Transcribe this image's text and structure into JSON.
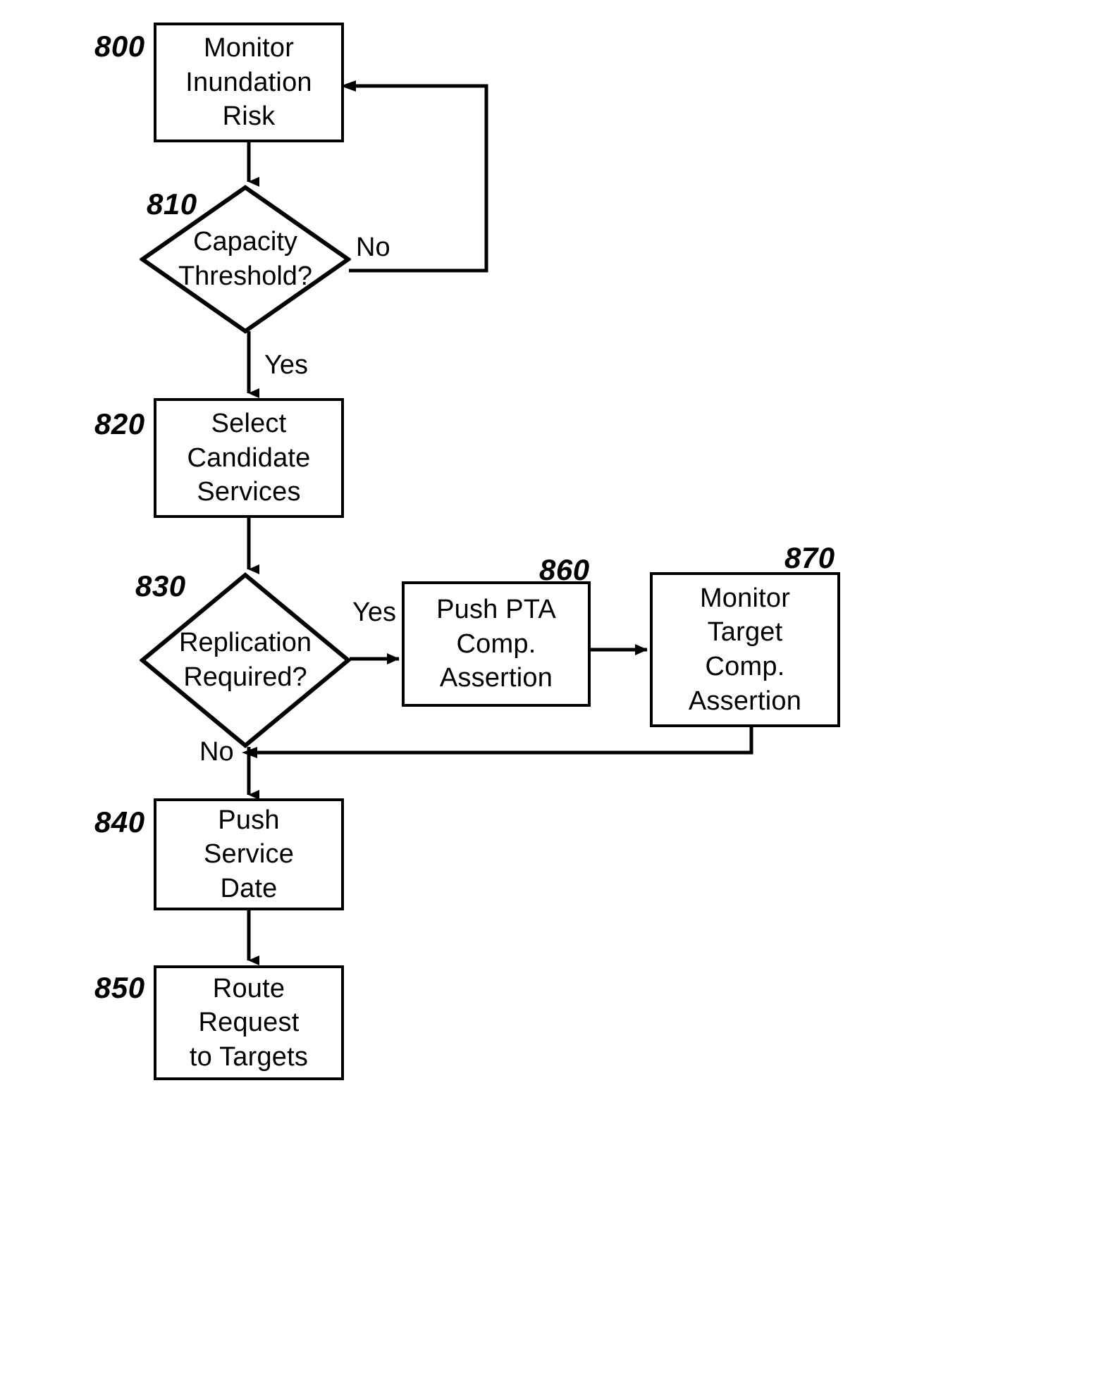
{
  "figure": {
    "kind": "patent-flowchart",
    "background_color": "#ffffff",
    "line_color": "#000000"
  },
  "nodes": {
    "n800": {
      "ref": "800",
      "shape": "process",
      "lines": [
        "Monitor",
        "Inundation",
        "Risk"
      ]
    },
    "n810": {
      "ref": "810",
      "shape": "decision",
      "lines": [
        "Capacity",
        "Threshold?"
      ]
    },
    "n820": {
      "ref": "820",
      "shape": "process",
      "lines": [
        "Select",
        "Candidate",
        "Services"
      ]
    },
    "n830": {
      "ref": "830",
      "shape": "decision",
      "lines": [
        "Replication",
        "Required?"
      ]
    },
    "n840": {
      "ref": "840",
      "shape": "process",
      "lines": [
        "Push",
        "Service",
        "Date"
      ]
    },
    "n850": {
      "ref": "850",
      "shape": "process",
      "lines": [
        "Route",
        "Request",
        "to Targets"
      ]
    },
    "n860": {
      "ref": "860",
      "shape": "process",
      "lines": [
        "Push PTA",
        "Comp.",
        "Assertion"
      ]
    },
    "n870": {
      "ref": "870",
      "shape": "process",
      "lines": [
        "Monitor",
        "Target",
        "Comp.",
        "Assertion"
      ]
    }
  },
  "edge_labels": {
    "e810_no": "No",
    "e810_yes": "Yes",
    "e830_yes": "Yes",
    "e830_no": "No"
  },
  "edges": [
    {
      "from": "n800",
      "to": "n810",
      "label": ""
    },
    {
      "from": "n810",
      "to": "n800",
      "label": "No"
    },
    {
      "from": "n810",
      "to": "n820",
      "label": "Yes"
    },
    {
      "from": "n820",
      "to": "n830",
      "label": ""
    },
    {
      "from": "n830",
      "to": "n860",
      "label": "Yes"
    },
    {
      "from": "n860",
      "to": "n870",
      "label": ""
    },
    {
      "from": "n870",
      "to": "n840",
      "label": ""
    },
    {
      "from": "n830",
      "to": "n840",
      "label": "No"
    },
    {
      "from": "n840",
      "to": "n850",
      "label": ""
    }
  ]
}
